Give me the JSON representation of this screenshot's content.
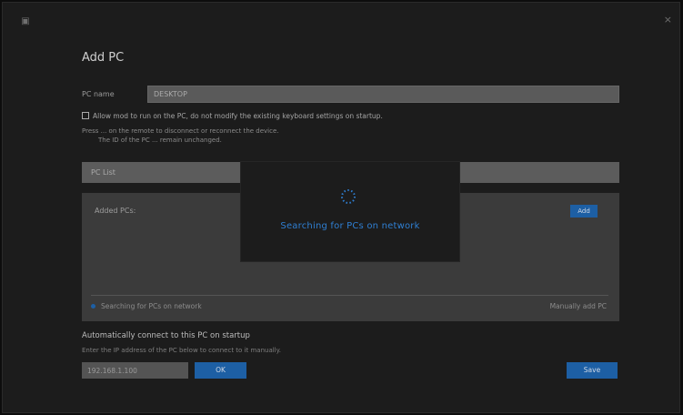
{
  "window": {
    "close_glyph": "×"
  },
  "dialog": {
    "title": "Add PC",
    "name_label": "PC name",
    "name_value": "DESKTOP",
    "checkbox_text": "Allow mod to run on the PC, do not modify the existing keyboard settings on startup.",
    "note_line1": "Press ... on the remote to disconnect or reconnect the device.",
    "note_line2": "The ID of the PC ... remain unchanged."
  },
  "section": {
    "header": "PC List",
    "list_label": "Added PCs:",
    "add_label": "Add",
    "footer_left": "Searching for PCs on network",
    "footer_right": "Manually add PC"
  },
  "bottom": {
    "label": "Automatically connect to this PC on startup",
    "note": "Enter the IP address of the PC below to connect to it manually.",
    "input_placeholder": "192.168.1.100",
    "ok_label": "OK",
    "save_label": "Save"
  },
  "overlay": {
    "status": "Searching for PCs on network"
  },
  "colors": {
    "accent": "#1d5fa4",
    "text_accent": "#2f7fd2"
  }
}
